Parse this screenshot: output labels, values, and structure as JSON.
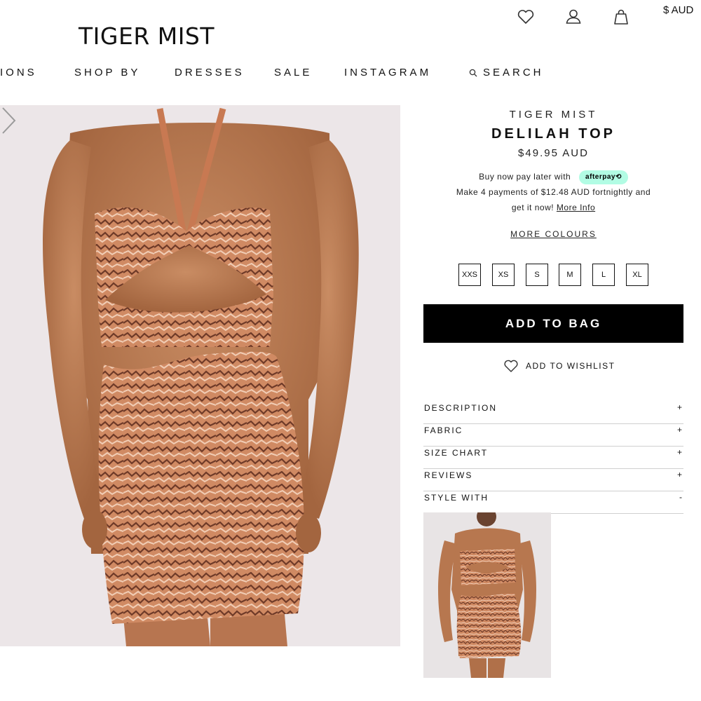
{
  "header": {
    "logo": "TIGER MIST",
    "currency": "$ AUD",
    "icons": [
      "heart-icon",
      "user-icon",
      "bag-icon"
    ]
  },
  "nav": {
    "items": [
      "IONS",
      "SHOP BY",
      "DRESSES",
      "SALE",
      "INSTAGRAM"
    ],
    "search_label": "SEARCH"
  },
  "product": {
    "brand": "TIGER MIST",
    "name": "DELILAH TOP",
    "price": "$49.95 AUD",
    "afterpay_line1": "Buy now pay later with",
    "afterpay_badge": "afterpay⟲",
    "afterpay_line2": "Make 4 payments of $12.48 AUD fortnightly and",
    "afterpay_line3": "get it now!",
    "more_info": "More Info",
    "more_colours": "MORE COLOURS",
    "sizes": [
      "XXS",
      "XS",
      "S",
      "M",
      "L",
      "XL"
    ],
    "add_to_bag": "ADD TO BAG",
    "wishlist": "ADD TO WISHLIST"
  },
  "accordion": [
    {
      "label": "DESCRIPTION",
      "sign": "+"
    },
    {
      "label": "FABRIC",
      "sign": "+"
    },
    {
      "label": "SIZE CHART",
      "sign": "+"
    },
    {
      "label": "REVIEWS",
      "sign": "+"
    },
    {
      "label": "STYLE WITH",
      "sign": "-"
    }
  ],
  "colors": {
    "accent_black": "#000000",
    "afterpay_mint": "#b2fce4",
    "photo_background": "#ece6e8",
    "garment_rust": "#c9714a"
  }
}
